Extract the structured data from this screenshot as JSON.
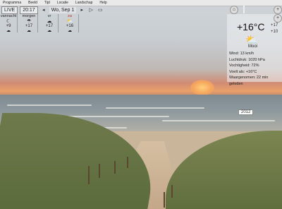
{
  "menu": [
    "Programma",
    "Beeld",
    "Tijd",
    "Locatie",
    "Landschap",
    "Help"
  ],
  "toolbar": {
    "live": "LIVE",
    "time": "20:17",
    "date": "Wo, Sep 1"
  },
  "forecast": [
    {
      "label": "vannacht",
      "temp": "+9",
      "icon": "moon-icon"
    },
    {
      "label": "morgen",
      "temp": "+17",
      "icon": "cloud-rain-icon"
    },
    {
      "label": "vr",
      "temp": "+17",
      "icon": "cloud-icon"
    },
    {
      "label": "za",
      "temp": "+16",
      "icon": "sun-cloud-icon"
    }
  ],
  "current": {
    "temp": "+16°C",
    "high": "+17",
    "low": "+10",
    "condition": "Mooi",
    "wind": "Wind:  13 km/h",
    "pressure": "Luchtdruk:  1020 hPa",
    "humidity": "Vochtigheid:  72%",
    "feels": "Voelt als:  +16°C",
    "observation": "Waargenomen:  22 min geleden"
  },
  "sign": "2012"
}
